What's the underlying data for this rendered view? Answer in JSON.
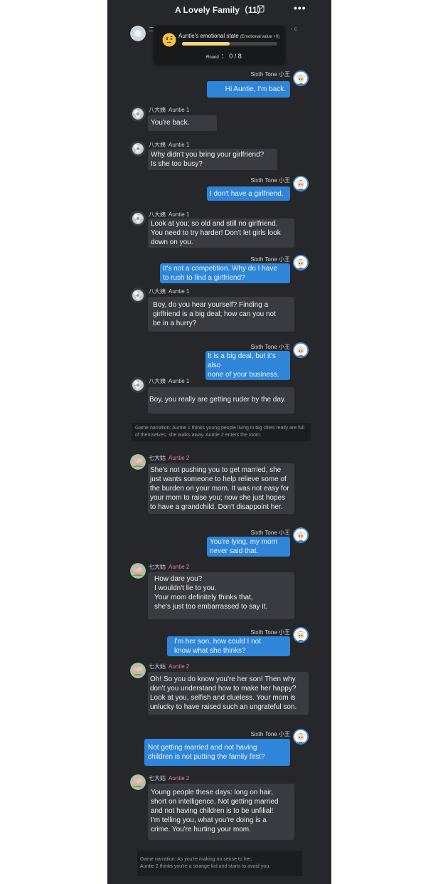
{
  "header": {
    "title": "A Lovely Family（11）",
    "more": "•••"
  },
  "status": {
    "label": "Auntie's emotional state",
    "sub": "(Emotional value +0)",
    "round_label": "Round",
    "round_value": "： 0 / 8",
    "progress": 0.5,
    "emoji": "thinking-face"
  },
  "partial_row": {
    "name_cn": "二",
    "text_fragment": "- c"
  },
  "messages": [
    {
      "side": "right",
      "name_en": "Sixth Tone",
      "name_cn": "小王",
      "text": "Hi Auntie, I'm back."
    },
    {
      "side": "left",
      "name_cn": "八大姨",
      "name_en": "Auntie 1",
      "text": "You're back."
    },
    {
      "side": "left",
      "name_cn": "八大姨",
      "name_en": "Auntie 1",
      "text": "Why didn't you bring your girlfriend?\nIs she too busy?"
    },
    {
      "side": "right",
      "name_en": "Sixth Tone",
      "name_cn": "小王",
      "text": "I don't have a girlfriend."
    },
    {
      "side": "left",
      "name_cn": "八大姨",
      "name_en": "Auntie 1",
      "text": "Look at you; so old and still no girlfriend.\nYou need to try harder! Don't let girls look\ndown on you."
    },
    {
      "side": "right",
      "name_en": "Sixth Tone",
      "name_cn": "小王",
      "text": "It's not a competition. Why do I have\nto rush to find a girlfriend?"
    },
    {
      "side": "left",
      "name_cn": "八大姨",
      "name_en": "Auntie 1",
      "text": "Boy, do you hear yourself? Finding a\ngirlfriend is a big deal; how can you not\nbe in a hurry?"
    },
    {
      "side": "right",
      "name_en": "Sixth Tone",
      "name_cn": "小王",
      "text": "It is a big deal, but it's also\nnone of your business."
    },
    {
      "side": "left",
      "name_cn": "八大姨",
      "name_en": "Auntie 1",
      "text": "Boy, you really are getting ruder by the day."
    },
    {
      "side": "left",
      "name_cn": "七大姑",
      "name_en": "Auntie 2",
      "text": "She's not pushing you to get married, she\njust wants someone to help relieve some of\nthe burden on your mom. It was not easy for\nyour mom to raise you; now she just hopes\nto have a grandchild. Don't disappoint her."
    },
    {
      "side": "right",
      "name_en": "Sixth Tone",
      "name_cn": "小王",
      "text": "You're lying, my mom\nnever said that."
    },
    {
      "side": "left",
      "name_cn": "七大姑",
      "name_en": "Auntie 2",
      "text": "How dare you?\nI wouldn't lie to you.\nYour mom definitely thinks that,\nshe's just too embarrassed to say it."
    },
    {
      "side": "right",
      "name_en": "Sixth Tone",
      "name_cn": "小王",
      "text": "I'm her son, how could I not\nknow what she thinks?"
    },
    {
      "side": "left",
      "name_cn": "七大姑",
      "name_en": "Auntie 2",
      "text": "Oh! So you do know you're her son! Then why\ndon't you understand how to make her happy?\nLook at you, selfish and clueless. Your mom is\nunlucky to have raised such an ungrateful son."
    },
    {
      "side": "right",
      "name_en": "Sixth Tone",
      "name_cn": "小王",
      "text": "Not getting married and not having\nchildren is not putting the family first?"
    },
    {
      "side": "left",
      "name_cn": "七大姑",
      "name_en": "Auntie 2",
      "text": "Young people these days: long on hair,\nshort on intelligence. Not getting married\nand not having children is to be unfilial!\nI'm telling you, what you're doing is a\ncrime. You're hurting your mom."
    }
  ],
  "narrations": [
    "Game narration: Auntie 1 thinks young people living in big cities really are full of themselves; she walks away. Auntie 2 enters the room.",
    "Game narration: As you're making no sense to her,\nAuntie 2 thinks you're a strange kid and starts to avoid you."
  ],
  "colors": {
    "phone_bg": "#26272b",
    "player_bubble": "#2f86d8",
    "npc_bubble": "#3a3b40",
    "auntie2_name": "#e87ea1",
    "progress_fill": "#f1d777"
  }
}
